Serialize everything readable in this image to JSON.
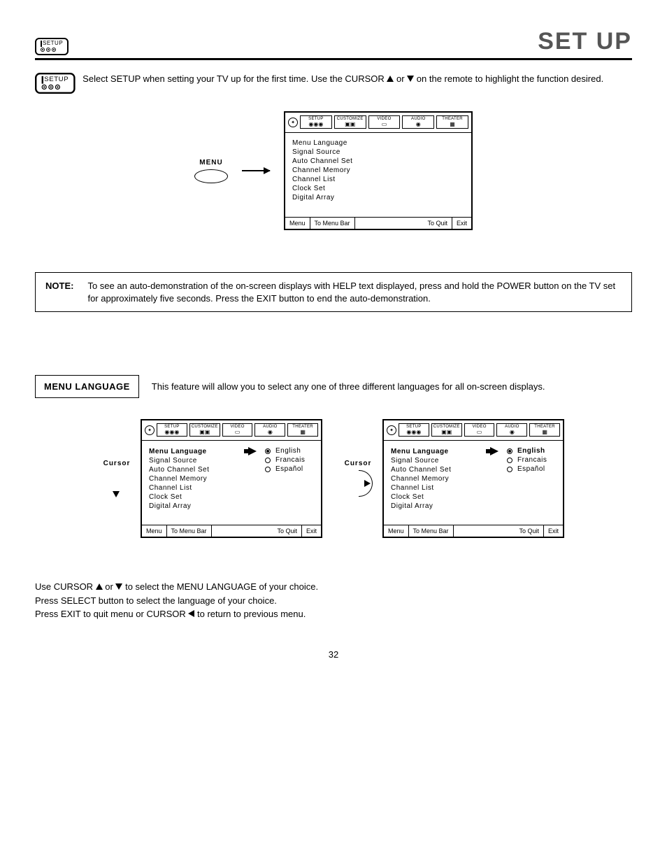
{
  "header": {
    "setup_icon_label": "SETUP",
    "page_title": "SET UP"
  },
  "intro": {
    "setup_icon_label": "SETUP",
    "text_before_up": "Select SETUP when setting your TV up for the first time.  Use the CURSOR ",
    "text_mid": " or ",
    "text_after_down": " on the remote to highlight the function desired."
  },
  "menu_button_label": "MENU",
  "osd_main": {
    "tabs": [
      "SETUP",
      "CUSTOMIZE",
      "VIDEO",
      "AUDIO",
      "THEATER"
    ],
    "items": [
      "Menu Language",
      "Signal Source",
      "Auto Channel Set",
      "Channel Memory",
      "Channel List",
      "Clock Set",
      "Digital Array"
    ],
    "footer": {
      "menu": "Menu",
      "to_menu_bar": "To Menu Bar",
      "to_quit": "To Quit",
      "exit": "Exit"
    }
  },
  "note": {
    "label": "NOTE:",
    "text": "To see an auto-demonstration of the on-screen displays with HELP text displayed, press and hold the POWER button on the TV set for approximately five seconds. Press the EXIT button to end the auto-demonstration."
  },
  "menu_language": {
    "heading": "MENU LANGUAGE",
    "desc": "This feature will allow you to select any one of three different languages for all on-screen displays."
  },
  "cursor_label": "Cursor",
  "osd_left": {
    "tabs": [
      "SETUP",
      "CUSTOMIZE",
      "VIDEO",
      "AUDIO",
      "THEATER"
    ],
    "items": [
      {
        "label": "Menu Language",
        "bold": true,
        "arrow": true
      },
      {
        "label": "Signal Source"
      },
      {
        "label": "Auto Channel Set"
      },
      {
        "label": "Channel Memory"
      },
      {
        "label": "Channel List"
      },
      {
        "label": "Clock Set"
      },
      {
        "label": "Digital Array"
      }
    ],
    "options": [
      {
        "label": "English",
        "selected": true,
        "bold": false
      },
      {
        "label": "Francais",
        "selected": false
      },
      {
        "label": "Español",
        "selected": false
      }
    ],
    "footer": {
      "menu": "Menu",
      "to_menu_bar": "To Menu Bar",
      "to_quit": "To Quit",
      "exit": "Exit"
    }
  },
  "osd_right": {
    "tabs": [
      "SETUP",
      "CUSTOMIZE",
      "VIDEO",
      "AUDIO",
      "THEATER"
    ],
    "items": [
      {
        "label": "Menu Language",
        "bold": true,
        "arrow": true
      },
      {
        "label": "Signal Source"
      },
      {
        "label": "Auto Channel Set"
      },
      {
        "label": "Channel Memory"
      },
      {
        "label": "Channel List"
      },
      {
        "label": "Clock Set"
      },
      {
        "label": "Digital Array"
      }
    ],
    "options": [
      {
        "label": "English",
        "selected": true,
        "bold": true
      },
      {
        "label": "Francais",
        "selected": false
      },
      {
        "label": "Español",
        "selected": false
      }
    ],
    "footer": {
      "menu": "Menu",
      "to_menu_bar": "To Menu Bar",
      "to_quit": "To Quit",
      "exit": "Exit"
    }
  },
  "instructions": {
    "line1_a": "Use CURSOR ",
    "line1_b": " or ",
    "line1_c": " to select the MENU LANGUAGE of your choice.",
    "line2": "Press SELECT button to select the language of your choice.",
    "line3_a": "Press EXIT to quit menu or CURSOR ",
    "line3_b": " to return to previous menu."
  },
  "page_number": "32"
}
